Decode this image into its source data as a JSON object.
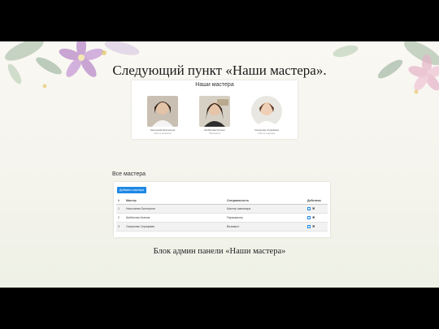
{
  "slide": {
    "title": "Следующий пункт «Наши мастера».",
    "caption": "Блок админ панели «Наши мастера»"
  },
  "masters_page": {
    "title": "Наши мастера",
    "cards": [
      {
        "name": "Николаева Екатерина",
        "role": "Мастер маникюра"
      },
      {
        "name": "Шибалова Ксения",
        "role": "Парикмахер"
      },
      {
        "name": "Смирнова Серафима",
        "role": "Мастер педикюра"
      }
    ]
  },
  "admin_panel": {
    "title": "Все мастера",
    "add_button": "Добавить мастера",
    "columns": [
      "#",
      "Мастер",
      "Специальность",
      "Действия"
    ],
    "rows": [
      {
        "num": "1",
        "name": "Николаева Екатерина",
        "specialty": "Мастер маникюра"
      },
      {
        "num": "2",
        "name": "Шибалова Ксения",
        "specialty": "Парикмахер"
      },
      {
        "num": "3",
        "name": "Смирнова Серафима",
        "specialty": "Визажист"
      }
    ]
  },
  "colors": {
    "accent": "#1e88e5",
    "background": "#faf8f3",
    "frame": "#000000"
  },
  "icons": [
    "edit-icon",
    "delete-icon"
  ]
}
